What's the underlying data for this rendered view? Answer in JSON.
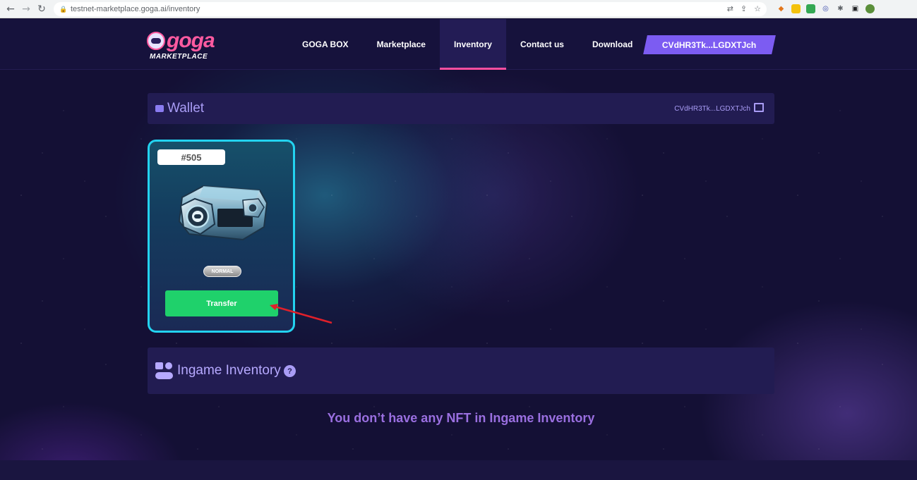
{
  "browser": {
    "url": "testnet-marketplace.goga.ai/inventory"
  },
  "header": {
    "logo_word": "goga",
    "logo_sub": "MARKETPLACE",
    "nav": [
      {
        "label": "GOGA BOX"
      },
      {
        "label": "Marketplace"
      },
      {
        "label": "Inventory",
        "active": true
      },
      {
        "label": "Contact us"
      },
      {
        "label": "Download"
      }
    ],
    "wallet_address": "CVdHR3Tk...LGDXTJch"
  },
  "wallet": {
    "title": "Wallet",
    "address": "CVdHR3Tk...LGDXTJch"
  },
  "card": {
    "id": "#505",
    "rarity": "NORMAL",
    "transfer_label": "Transfer"
  },
  "ingame": {
    "title": "Ingame Inventory",
    "help": "?",
    "empty_message": "You don’t have any NFT in Ingame Inventory"
  },
  "colors": {
    "accent": "#7c5cf2",
    "card_border": "#23d3f0",
    "transfer": "#1fd16b",
    "nav_active": "#ff4fa0",
    "annotation_arrow": "#e0202a"
  },
  "icons": [
    "back-icon",
    "forward-icon",
    "reload-icon",
    "lock-icon",
    "wallet-icon",
    "copy-icon",
    "gamepad-icon",
    "help-icon"
  ]
}
